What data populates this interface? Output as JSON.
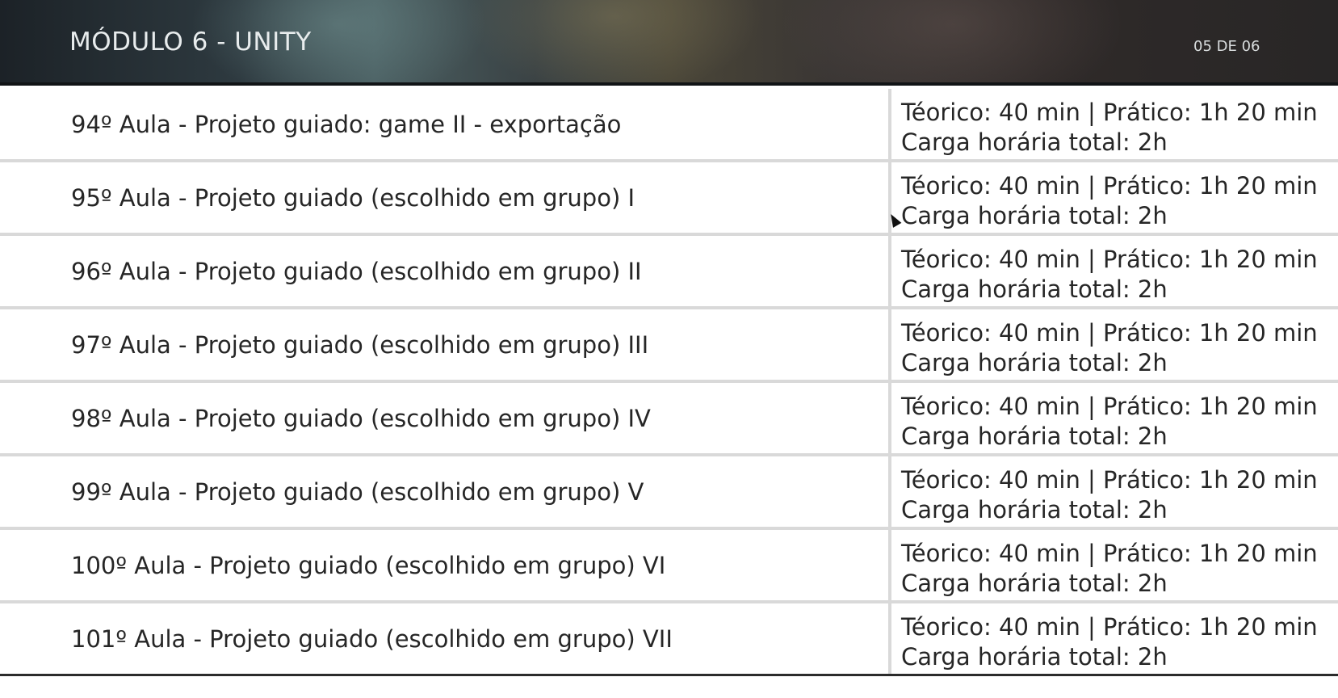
{
  "header": {
    "title": "MÓDULO 6 - UNITY",
    "page_indicator": "05 DE 06"
  },
  "rows": [
    {
      "lesson": "94º Aula - Projeto guiado: game II - exportação",
      "time": "Téorico: 40 min | Prático: 1h 20 min",
      "load": "Carga horária total: 2h"
    },
    {
      "lesson": "95º Aula - Projeto guiado (escolhido em grupo) I",
      "time": "Téorico: 40 min | Prático: 1h 20 min",
      "load": "Carga horária total: 2h"
    },
    {
      "lesson": "96º Aula - Projeto guiado (escolhido em grupo) II",
      "time": "Téorico: 40 min | Prático: 1h 20 min",
      "load": "Carga horária total: 2h"
    },
    {
      "lesson": "97º Aula - Projeto guiado (escolhido em grupo) III",
      "time": "Téorico: 40 min | Prático: 1h 20 min",
      "load": "Carga horária total: 2h"
    },
    {
      "lesson": "98º Aula - Projeto guiado (escolhido em grupo) IV",
      "time": "Téorico: 40 min | Prático: 1h 20 min",
      "load": "Carga horária total: 2h"
    },
    {
      "lesson": "99º Aula - Projeto guiado (escolhido em grupo) V",
      "time": "Téorico: 40 min | Prático: 1h 20 min",
      "load": "Carga horária total: 2h"
    },
    {
      "lesson": "100º Aula - Projeto guiado (escolhido em grupo) VI",
      "time": "Téorico: 40 min | Prático: 1h 20 min",
      "load": "Carga horária total: 2h"
    },
    {
      "lesson": "101º Aula - Projeto guiado (escolhido em grupo) VII",
      "time": "Téorico: 40 min | Prático: 1h 20 min",
      "load": "Carga horária total: 2h"
    }
  ]
}
